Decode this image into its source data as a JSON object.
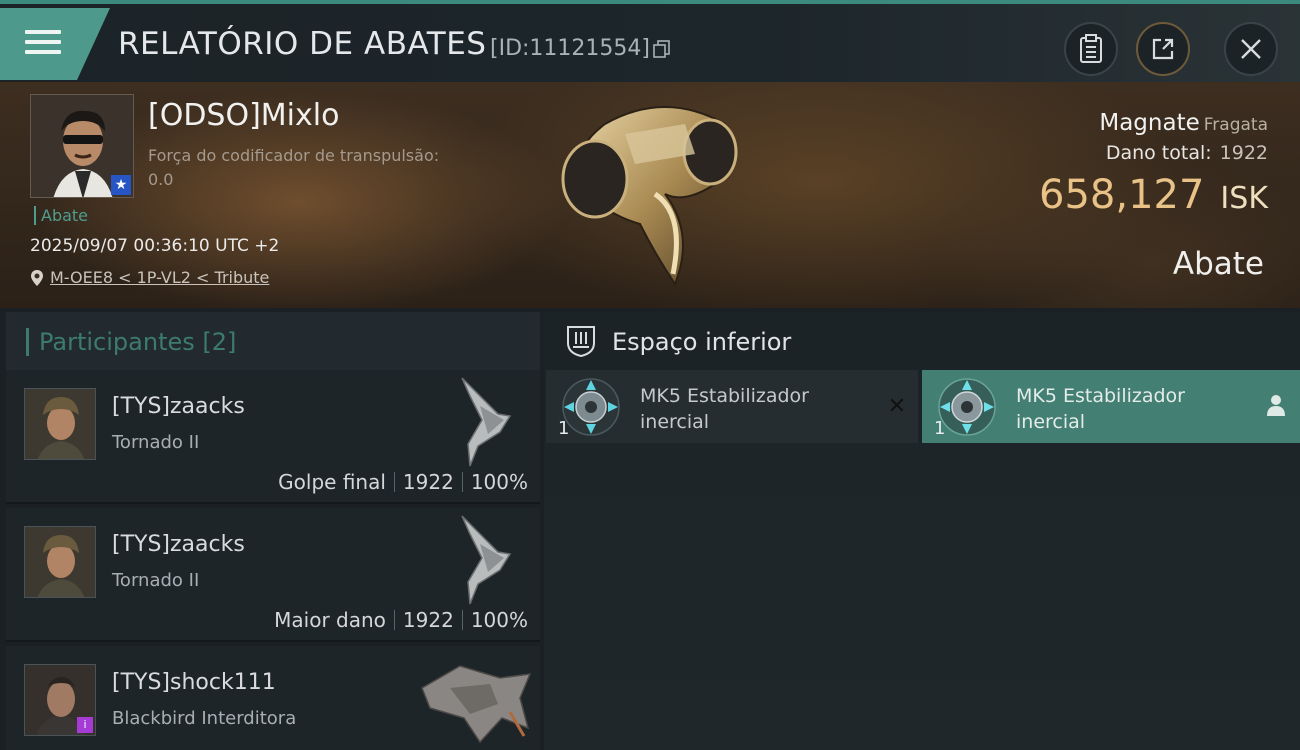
{
  "header": {
    "title": "RELATÓRIO DE ABATES",
    "report_id": "[ID:11121554]"
  },
  "victim": {
    "name": "[ODSO]Mixlo",
    "attribute_label": "Força do codificador de transpulsão:",
    "attribute_value": "0.0",
    "tag": "Abate",
    "timestamp": "2025/09/07 00:36:10 UTC +2",
    "location": "M-OEE8 < 1P-VL2 < Tribute",
    "ship_name": "Magnate",
    "ship_class": "Fragata",
    "damage_label": "Dano total:",
    "damage_value": "1922",
    "isk_value": "658,127",
    "isk_unit": "ISK",
    "result": "Abate"
  },
  "participants": {
    "label": "Participantes",
    "count": "[2]",
    "items": [
      {
        "name": "[TYS]zaacks",
        "ship": "Tornado II",
        "role": "Golpe final",
        "damage": "1922",
        "percent": "100%"
      },
      {
        "name": "[TYS]zaacks",
        "ship": "Tornado II",
        "role": "Maior dano",
        "damage": "1922",
        "percent": "100%"
      },
      {
        "name": "[TYS]shock111",
        "ship": "Blackbird Interditora",
        "role": "",
        "damage": "",
        "percent": ""
      }
    ]
  },
  "fitting": {
    "slot_title": "Espaço inferior",
    "modules": [
      {
        "name_line1": "MK5 Estabilizador",
        "name_line2": "inercial",
        "qty": "1",
        "status": "destroyed"
      },
      {
        "name_line1": "MK5 Estabilizador",
        "name_line2": "inercial",
        "qty": "1",
        "status": "dropped"
      }
    ]
  },
  "icons": [
    "menu-icon",
    "copy-icon",
    "clipboard-icon",
    "share-icon",
    "close-icon",
    "location-pin-icon",
    "star-icon",
    "low-slot-icon",
    "destroyed-x-icon",
    "person-icon"
  ],
  "colors": {
    "accent": "#4d9a8c",
    "isk": "#e9c287",
    "background": "#1a2024",
    "purple_badge": "#a53ad4"
  }
}
